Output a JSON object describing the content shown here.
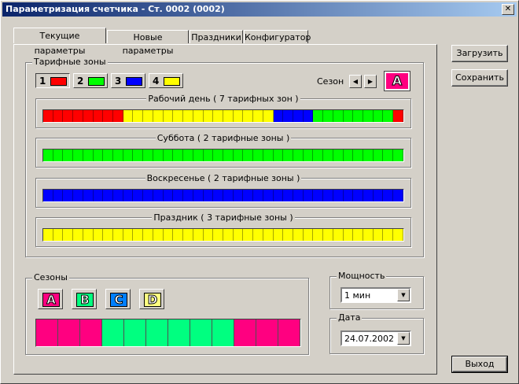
{
  "window": {
    "title": "Параметризация счетчика - Ст. 0002 (0002)",
    "close_glyph": "✕"
  },
  "tabs": [
    {
      "label": "Текущие параметры",
      "active": true
    },
    {
      "label": "Новые параметры",
      "active": false
    },
    {
      "label": "Праздники",
      "active": false
    },
    {
      "label": "Конфигуратор",
      "active": false
    }
  ],
  "tariff_zones": {
    "title": "Тарифные зоны",
    "zones": [
      {
        "number": "1",
        "color": "#ff0000"
      },
      {
        "number": "2",
        "color": "#00ff00"
      },
      {
        "number": "3",
        "color": "#0000ff"
      },
      {
        "number": "4",
        "color": "#ffff00"
      }
    ],
    "season_label": "Сезон",
    "prev_glyph": "◀",
    "next_glyph": "▶",
    "current_season": "A",
    "current_season_color": "#ff0080",
    "days": [
      {
        "label": "Рабочий день ( 7 тарифных зон )",
        "segments": [
          {
            "zone": 1,
            "count": 8
          },
          {
            "zone": 4,
            "count": 15
          },
          {
            "zone": 3,
            "count": 4
          },
          {
            "zone": 2,
            "count": 8
          },
          {
            "zone": 1,
            "count": 1
          }
        ]
      },
      {
        "label": "Суббота ( 2 тарифные зоны )",
        "segments": [
          {
            "zone": 2,
            "count": 36
          }
        ]
      },
      {
        "label": "Воскресенье ( 2 тарифные зоны )",
        "segments": [
          {
            "zone": 3,
            "count": 36
          }
        ]
      },
      {
        "label": "Праздник ( 3 тарифные зоны )",
        "segments": [
          {
            "zone": 4,
            "count": 36
          }
        ]
      }
    ]
  },
  "seasons": {
    "title": "Сезоны",
    "buttons": [
      {
        "label": "A",
        "color": "#ff0080"
      },
      {
        "label": "B",
        "color": "#00ff80"
      },
      {
        "label": "C",
        "color": "#0080ff"
      },
      {
        "label": "D",
        "color": "#ffff80"
      }
    ],
    "months": [
      "A",
      "A",
      "A",
      "B",
      "B",
      "B",
      "B",
      "B",
      "B",
      "A",
      "A",
      "A"
    ]
  },
  "power": {
    "title": "Мощность",
    "value": "1 мин"
  },
  "date": {
    "title": "Дата",
    "value": "24.07.2002"
  },
  "buttons": {
    "load": "Загрузить",
    "save": "Сохранить",
    "exit": "Выход"
  }
}
